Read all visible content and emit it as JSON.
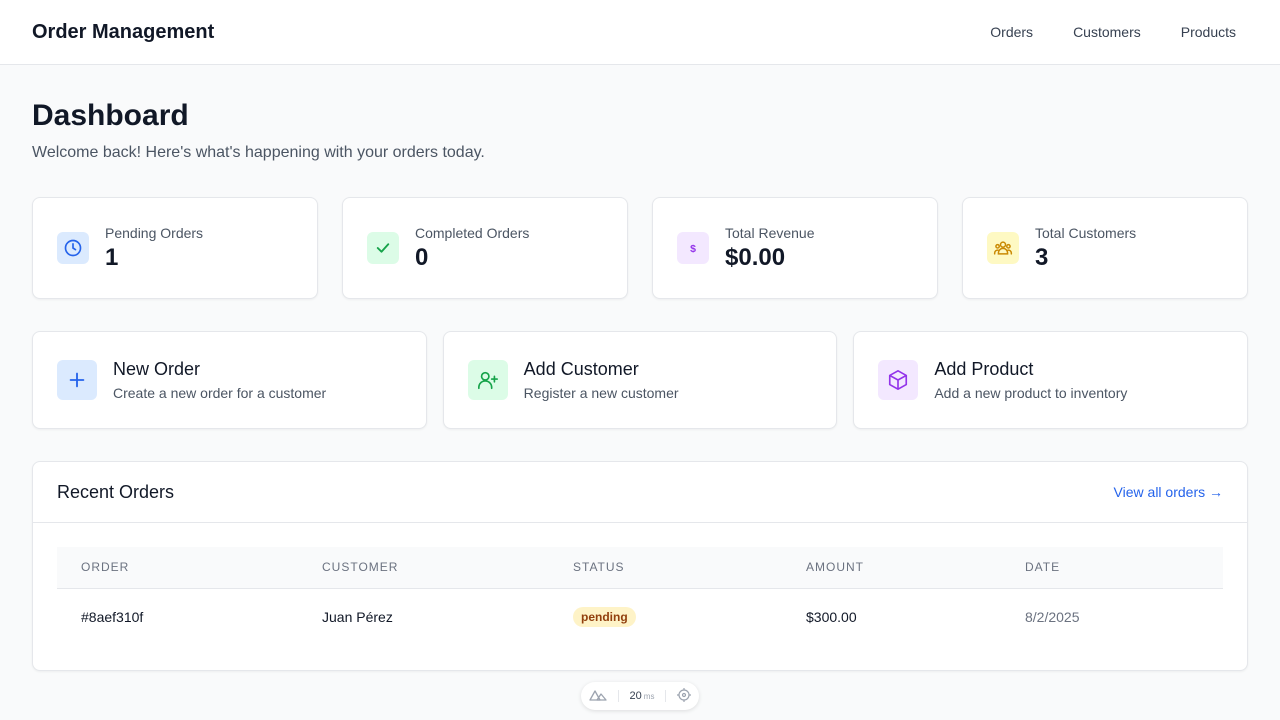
{
  "header": {
    "title": "Order Management",
    "nav": [
      "Orders",
      "Customers",
      "Products"
    ]
  },
  "page": {
    "title": "Dashboard",
    "subtitle": "Welcome back! Here's what's happening with your orders today."
  },
  "stats": [
    {
      "label": "Pending Orders",
      "value": "1",
      "icon": "clock-icon",
      "bg": "#dbeafe",
      "color": "#2563eb"
    },
    {
      "label": "Completed Orders",
      "value": "0",
      "icon": "check-icon",
      "bg": "#dcfce7",
      "color": "#16a34a"
    },
    {
      "label": "Total Revenue",
      "value": "$0.00",
      "icon": "dollar-icon",
      "bg": "#f3e8ff",
      "color": "#9333ea"
    },
    {
      "label": "Total Customers",
      "value": "3",
      "icon": "users-icon",
      "bg": "#fef9c3",
      "color": "#ca8a04"
    }
  ],
  "actions": [
    {
      "title": "New Order",
      "desc": "Create a new order for a customer",
      "icon": "plus-icon",
      "bg": "#dbeafe",
      "color": "#2563eb"
    },
    {
      "title": "Add Customer",
      "desc": "Register a new customer",
      "icon": "user-plus-icon",
      "bg": "#dcfce7",
      "color": "#16a34a"
    },
    {
      "title": "Add Product",
      "desc": "Add a new product to inventory",
      "icon": "cube-icon",
      "bg": "#f3e8ff",
      "color": "#9333ea"
    }
  ],
  "recent_orders": {
    "title": "Recent Orders",
    "view_all": "View all orders →",
    "columns": [
      "ORDER",
      "CUSTOMER",
      "STATUS",
      "AMOUNT",
      "DATE"
    ],
    "rows": [
      {
        "order": "#8aef310f",
        "customer": "Juan Pérez",
        "status": "pending",
        "amount": "$300.00",
        "date": "8/2/2025"
      }
    ]
  },
  "devtools": {
    "time": "20",
    "unit": "ms"
  }
}
